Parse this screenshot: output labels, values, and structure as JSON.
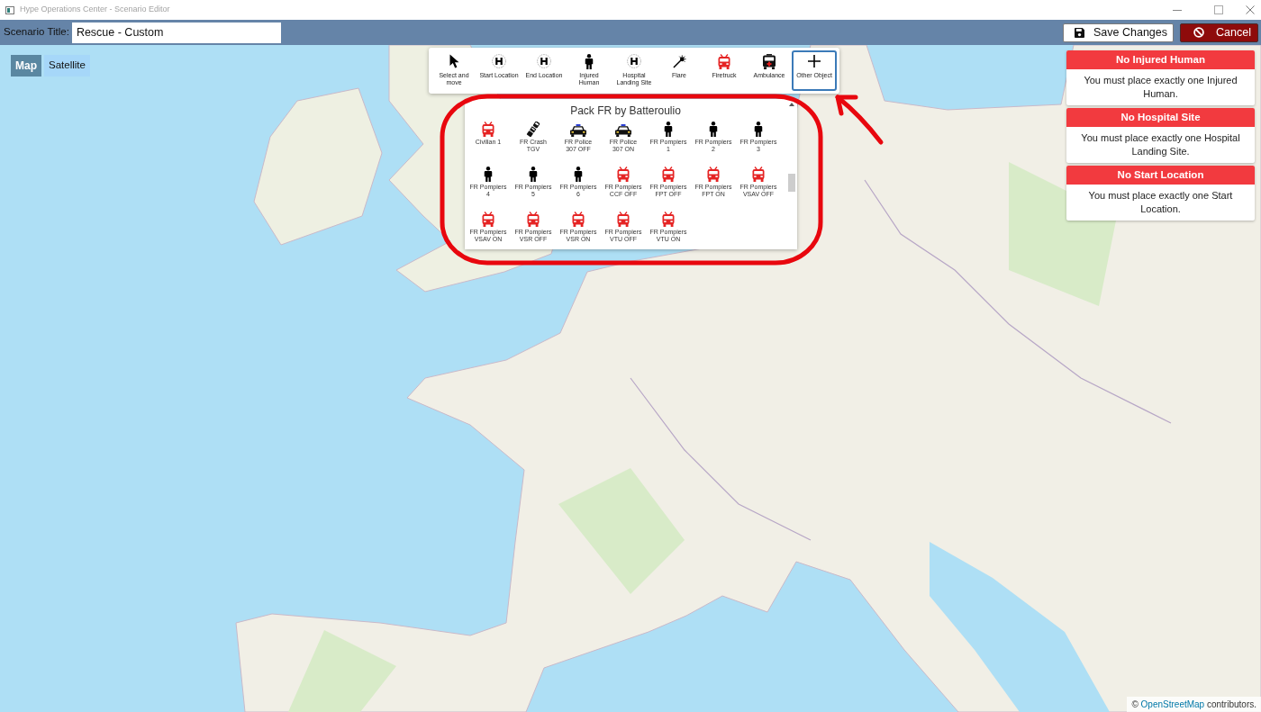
{
  "window": {
    "title": "Hype Operations Center - Scenario Editor"
  },
  "header": {
    "title_label": "Scenario Title:",
    "title_value": "Rescue - Custom",
    "buttons": [
      {
        "label": "Save Changes",
        "kind": "save"
      },
      {
        "label": "Cancel",
        "kind": "cancel"
      }
    ]
  },
  "map_type": [
    {
      "label": "Map",
      "selected": true
    },
    {
      "label": "Satellite",
      "selected": false
    }
  ],
  "toolbar": [
    {
      "label": "Select and move",
      "kind": "cursor",
      "selected": false
    },
    {
      "label": "Start Location",
      "kind": "helipad",
      "selected": false
    },
    {
      "label": "End Location",
      "kind": "helipad",
      "selected": false
    },
    {
      "label": "Injured Human",
      "kind": "person",
      "selected": false
    },
    {
      "label": "Hospital Landing Site",
      "kind": "helipad",
      "selected": false
    },
    {
      "label": "Flare",
      "kind": "flare",
      "selected": false
    },
    {
      "label": "Firetruck",
      "kind": "firetruck",
      "selected": false
    },
    {
      "label": "Ambulance",
      "kind": "ambulance",
      "selected": false
    },
    {
      "label": "Other Object",
      "kind": "plus",
      "selected": true
    }
  ],
  "object_pack": {
    "title": "Pack FR by Batteroulio",
    "items": [
      {
        "label": "Civilian 1",
        "kind": "truck"
      },
      {
        "label": "FR Crash TGV",
        "kind": "train"
      },
      {
        "label": "FR Police 307 OFF",
        "kind": "police"
      },
      {
        "label": "FR Police 307 ON",
        "kind": "police"
      },
      {
        "label": "FR Pompiers 1",
        "kind": "person"
      },
      {
        "label": "FR Pompiers 2",
        "kind": "person"
      },
      {
        "label": "FR Pompiers 3",
        "kind": "person"
      },
      {
        "label": "FR Pompiers 4",
        "kind": "person"
      },
      {
        "label": "FR Pompiers 5",
        "kind": "person"
      },
      {
        "label": "FR Pompiers 6",
        "kind": "person"
      },
      {
        "label": "FR Pompiers CCF OFF",
        "kind": "truck"
      },
      {
        "label": "FR Pompiers FPT OFF",
        "kind": "truck"
      },
      {
        "label": "FR Pompiers FPT ON",
        "kind": "truck"
      },
      {
        "label": "FR Pompiers VSAV OFF",
        "kind": "truck"
      },
      {
        "label": "FR Pompiers VSAV ON",
        "kind": "truck"
      },
      {
        "label": "FR Pompiers VSR OFF",
        "kind": "truck"
      },
      {
        "label": "FR Pompiers VSR ON",
        "kind": "truck"
      },
      {
        "label": "FR Pompiers VTU OFF",
        "kind": "truck"
      },
      {
        "label": "FR Pompiers VTU ON",
        "kind": "truck"
      }
    ]
  },
  "validation_messages": [
    {
      "title": "No Injured Human",
      "message": "You must place exactly one Injured Human."
    },
    {
      "title": "No Hospital Site",
      "message": "You must place exactly one Hospital Landing Site."
    },
    {
      "title": "No Start Location",
      "message": "You must place exactly one Start Location."
    }
  ],
  "attribution": {
    "prefix": "©",
    "link": "OpenStreetMap",
    "suffix": "contributors."
  }
}
